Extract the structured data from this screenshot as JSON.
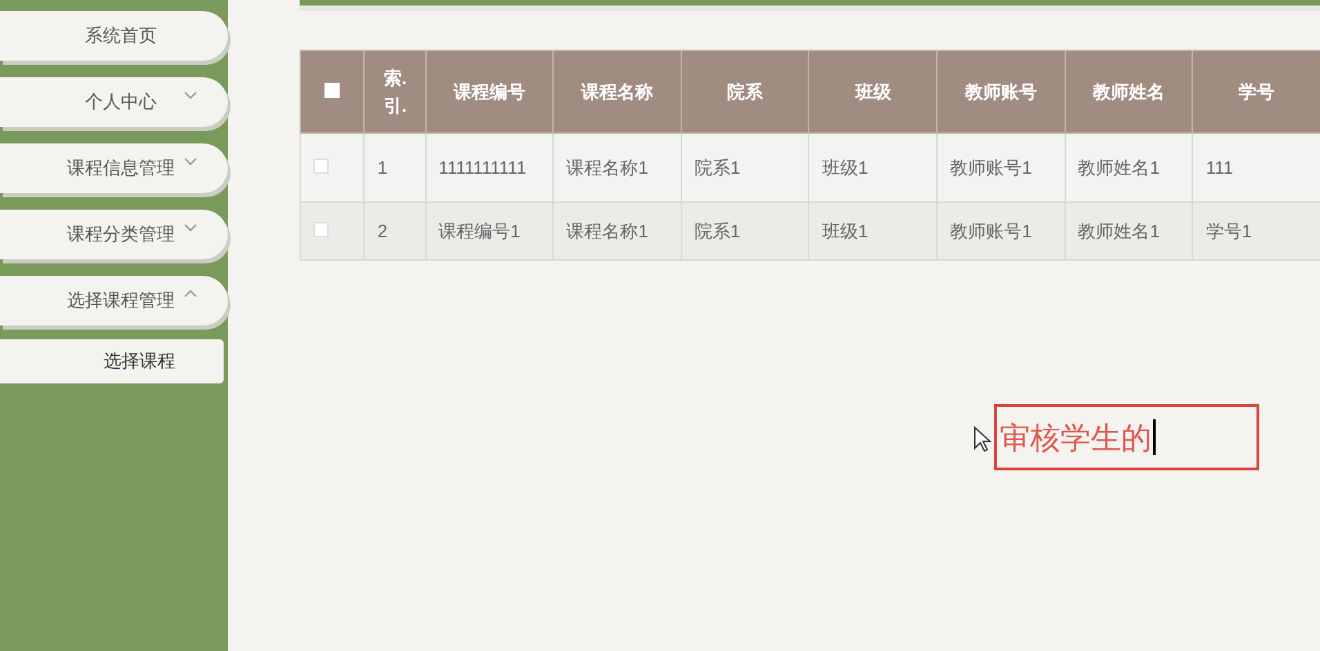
{
  "sidebar": {
    "items": [
      {
        "label": "系统首页",
        "kind": "link"
      },
      {
        "label": "个人中心",
        "kind": "group",
        "expanded": false
      },
      {
        "label": "课程信息管理",
        "kind": "group",
        "expanded": false
      },
      {
        "label": "课程分类管理",
        "kind": "group",
        "expanded": false
      },
      {
        "label": "选择课程管理",
        "kind": "group",
        "expanded": true,
        "children": [
          {
            "label": "选择课程"
          }
        ]
      }
    ]
  },
  "table": {
    "select_all": {
      "checked": false
    },
    "columns": [
      "索.引.",
      "课程编号",
      "课程名称",
      "院系",
      "班级",
      "教师账号",
      "教师姓名",
      "学号"
    ],
    "rows": [
      {
        "checked": false,
        "cells": [
          "1",
          "1111111111",
          "课程名称1",
          "院系1",
          "班级1",
          "教师账号1",
          "教师姓名1",
          "111"
        ]
      },
      {
        "checked": false,
        "cells": [
          "2",
          "课程编号1",
          "课程名称1",
          "院系1",
          "班级1",
          "教师账号1",
          "教师姓名1",
          "学号1"
        ]
      }
    ]
  },
  "annotation": {
    "value": "审核学生的"
  }
}
